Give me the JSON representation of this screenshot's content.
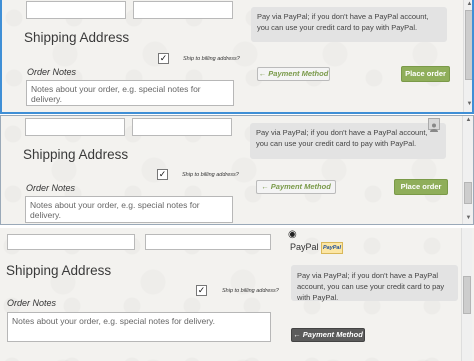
{
  "checkout": {
    "shipping_heading": "Shipping Address",
    "ship_to_billing_label": "Ship to billing address?",
    "ship_to_billing_checked": true,
    "order_notes_label": "Order Notes",
    "order_notes_placeholder": "Notes about your order, e.g. special notes for delivery.",
    "paypal_description": "Pay via PayPal; if you don't have a PayPal account, you can use your credit card to pay with PayPal.",
    "payment_method_button": "← Payment Method",
    "place_order_button": "Place order",
    "paypal_label": "PayPal",
    "paypal_logo_text": "PayPal"
  },
  "icons": {
    "check": "✓",
    "radio_selected": "◉",
    "scroll_up": "▲",
    "scroll_down": "▼"
  }
}
